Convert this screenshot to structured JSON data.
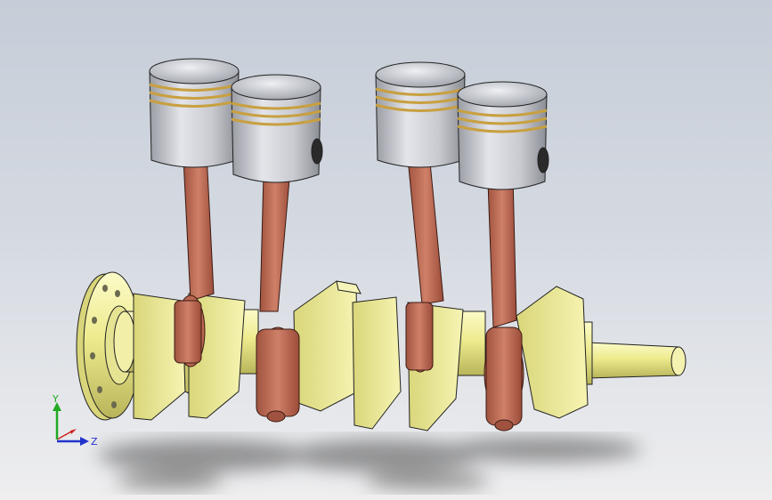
{
  "viewport": {
    "background_top": "#c6cdd8",
    "background_bottom": "#eeeeef",
    "model_parts": [
      "crankshaft",
      "flywheel-flange",
      "connecting-rods",
      "pistons"
    ],
    "colors": {
      "crankshaft": "#f0ee92",
      "connecting_rod": "#c0705a",
      "piston": "#c4c6cc",
      "piston_ring": "#c8a040",
      "shadow": "#555555"
    }
  },
  "triad": {
    "y_label": "Y",
    "z_label": "Z",
    "x_axis_color": "#cc2222",
    "y_axis_color": "#22aa22",
    "z_axis_color": "#2233cc"
  }
}
